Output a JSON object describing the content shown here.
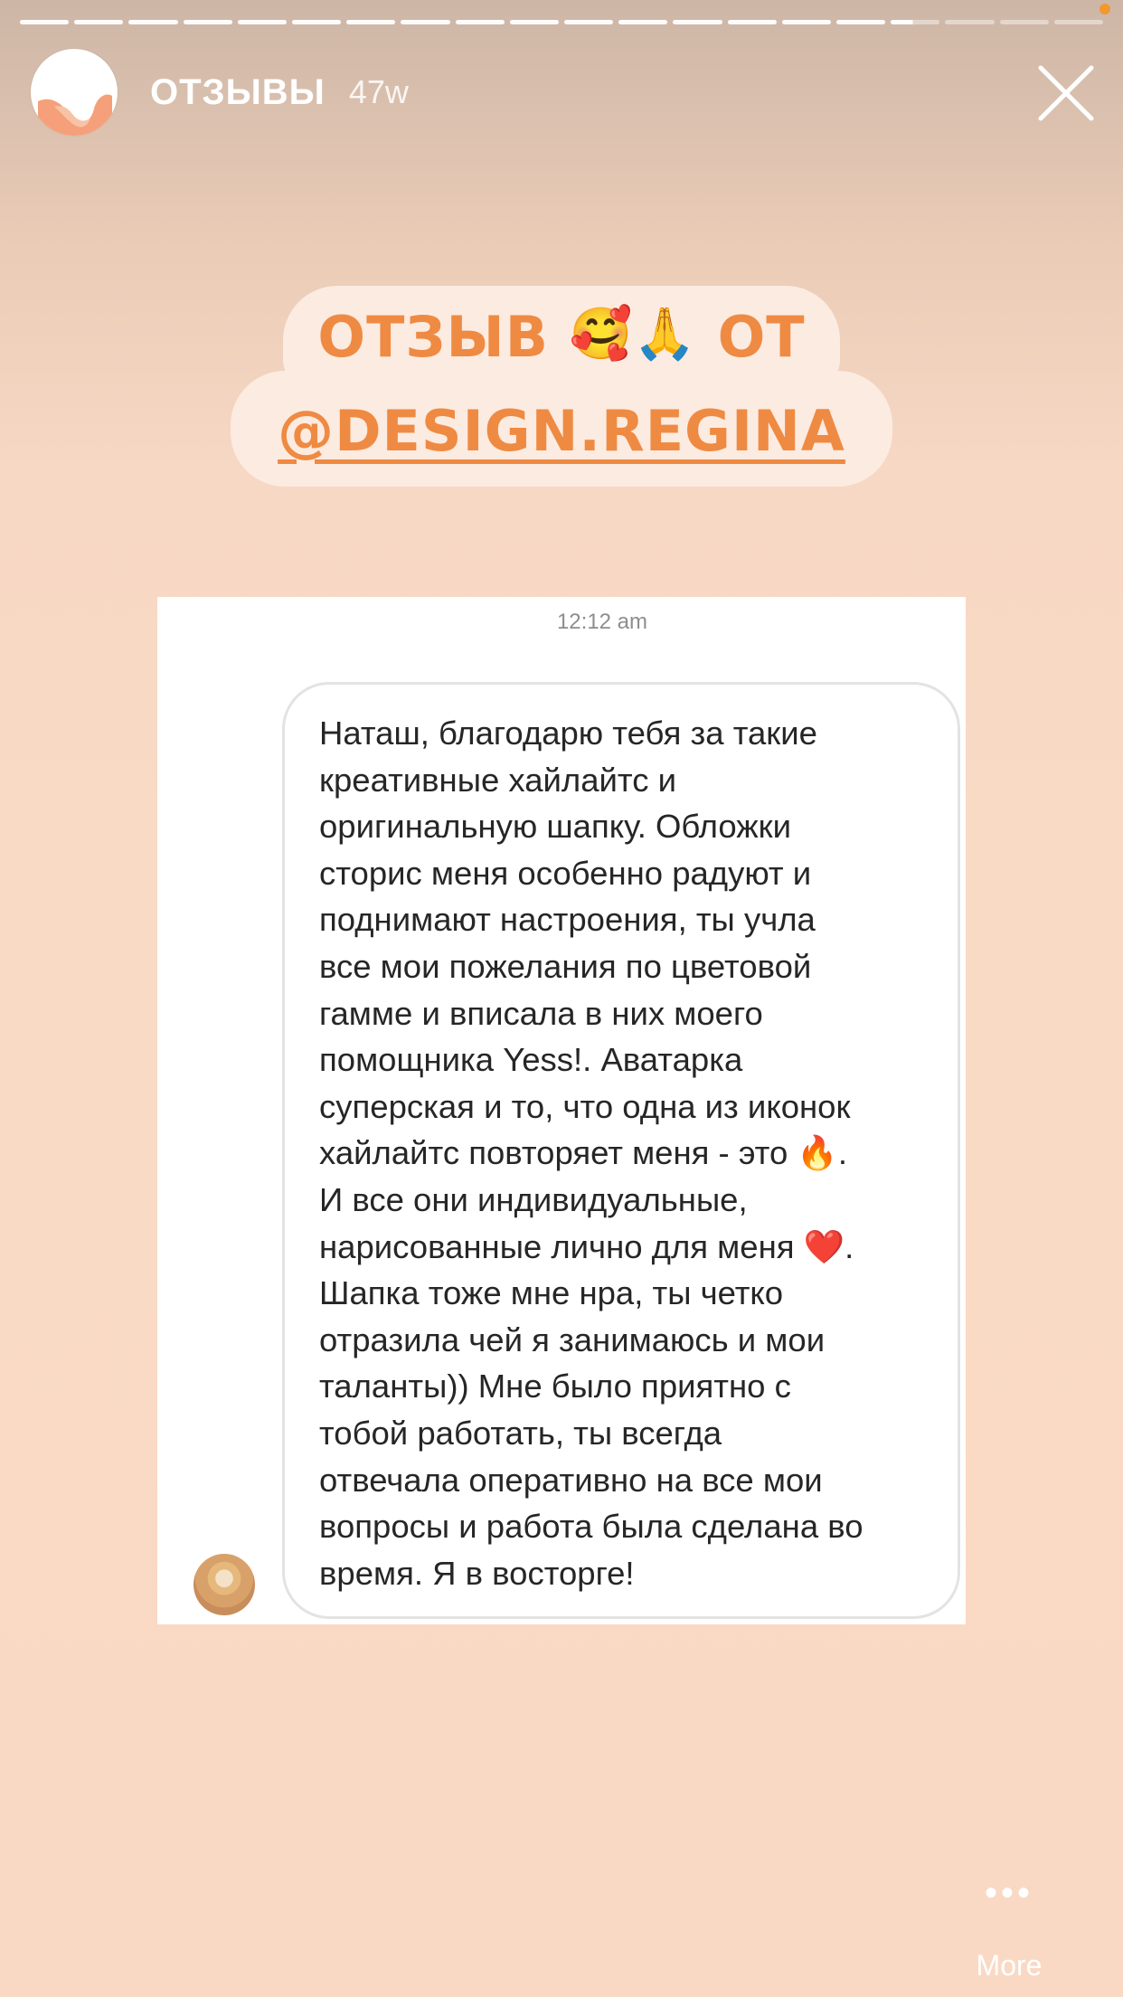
{
  "story": {
    "title": "ОТЗЫВЫ",
    "time_ago": "47w",
    "segments_total": 20,
    "segments_done": 16,
    "active_segment_progress": 0.45
  },
  "sticker": {
    "line1_text": "ОТЗЫВ",
    "line1_emoji": "🥰🙏",
    "line1_suffix": "ОТ",
    "line2": "@DESIGN.REGINA"
  },
  "message": {
    "timestamp": "12:12 am",
    "lines": [
      "Наташ, благодарю тебя за такие",
      "креативные хайлайтс и",
      "оригинальную шапку. Обложки",
      "сторис меня особенно радуют и",
      "поднимают настроения, ты учла",
      "все мои пожелания по цветовой",
      "гамме и вписала в них моего",
      "помощника Yess!. Аватарка",
      "суперская и то, что одна из иконок",
      "хайлайтс повторяет меня - это 🔥.",
      "И все они индивидуальные,",
      "нарисованные лично для меня ❤️.",
      "Шапка тоже мне нра, ты четко",
      "отразила чей я занимаюсь и мои",
      "таланты)) Мне было приятно с",
      "тобой работать, ты всегда",
      "отвечала оперативно на все мои",
      "вопросы и работа была сделана во",
      "время. Я в восторге!"
    ]
  },
  "footer": {
    "more_dots": "•••",
    "more_label": "More"
  },
  "colors": {
    "sticker_text": "#ef8a43",
    "sticker_bg": "#fcebe0",
    "background": "#fad9c4",
    "notification_dot": "#f2982d"
  },
  "icons": {
    "close": "close-icon",
    "more": "more-dots-icon"
  }
}
